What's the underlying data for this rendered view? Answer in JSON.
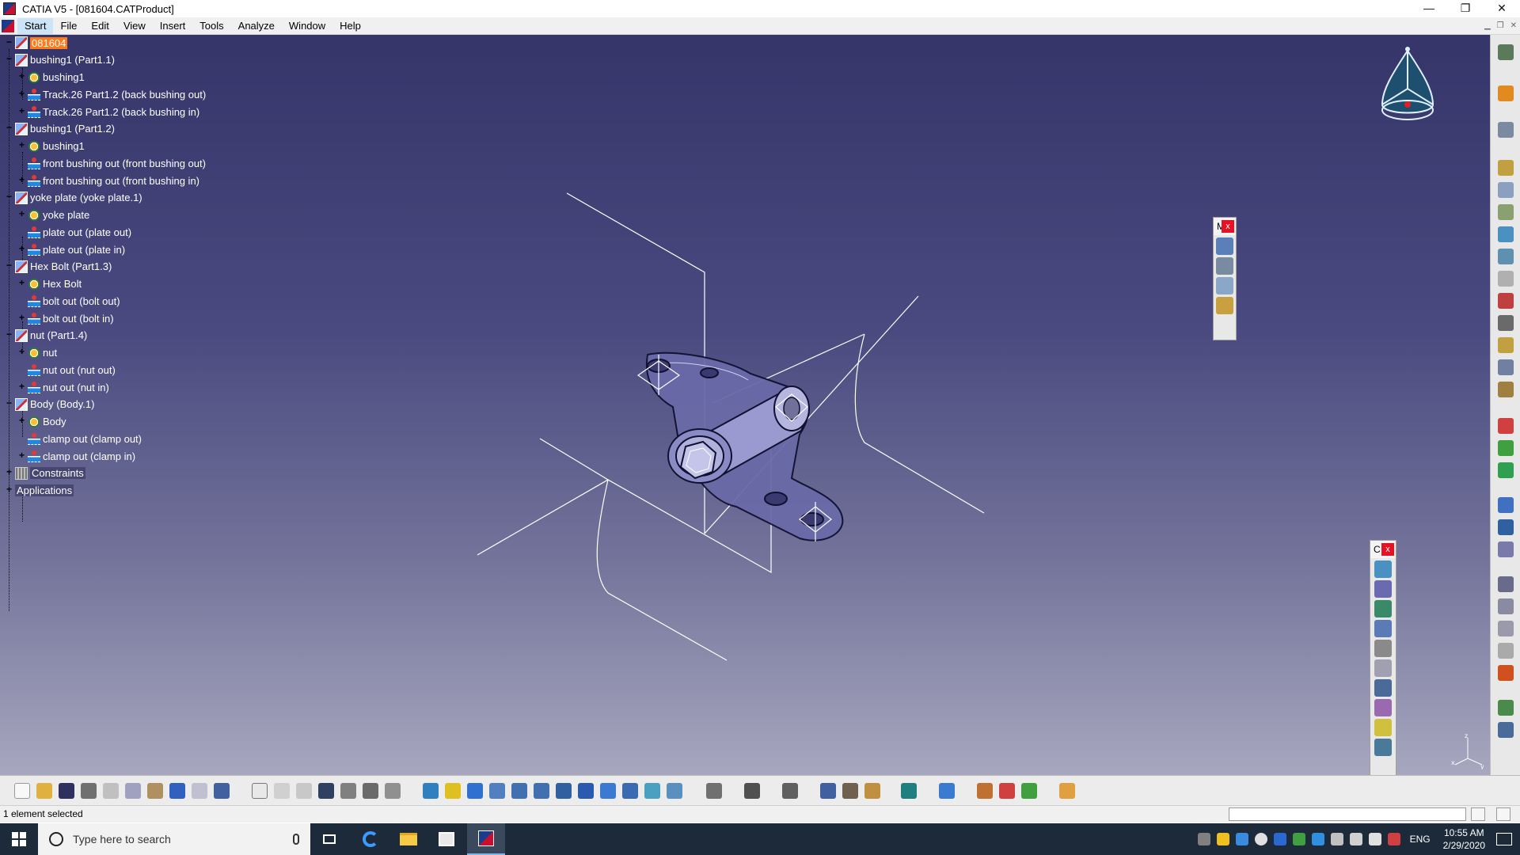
{
  "window": {
    "title": "CATIA V5 - [081604.CATProduct]",
    "minimize": "—",
    "maximize": "❐",
    "close": "✕"
  },
  "menu": {
    "items": [
      "Start",
      "File",
      "Edit",
      "View",
      "Insert",
      "Tools",
      "Analyze",
      "Window",
      "Help"
    ]
  },
  "tree": {
    "nodes": [
      {
        "label": "081604",
        "icon": "product-icon",
        "level": 0,
        "exp": "minus",
        "selected": true
      },
      {
        "label": "bushing1 (Part1.1)",
        "icon": "product-icon",
        "level": 1,
        "exp": "minus"
      },
      {
        "label": "bushing1",
        "icon": "part-icon",
        "level": 2,
        "exp": "plus"
      },
      {
        "label": "Track.26 Part1.2 (back bushing out)",
        "icon": "publication-icon",
        "level": 2,
        "exp": "plus"
      },
      {
        "label": "Track.26 Part1.2 (back bushing in)",
        "icon": "publication-icon",
        "level": 2,
        "exp": "plus"
      },
      {
        "label": "bushing1 (Part1.2)",
        "icon": "product-icon",
        "level": 1,
        "exp": "minus"
      },
      {
        "label": "bushing1",
        "icon": "part-icon",
        "level": 2,
        "exp": "plus"
      },
      {
        "label": "front bushing out (front bushing out)",
        "icon": "publication-icon",
        "level": 2,
        "exp": "none"
      },
      {
        "label": "front bushing out (front bushing in)",
        "icon": "publication-icon",
        "level": 2,
        "exp": "plus"
      },
      {
        "label": "yoke plate (yoke plate.1)",
        "icon": "product-icon",
        "level": 1,
        "exp": "minus"
      },
      {
        "label": "yoke plate",
        "icon": "part-icon",
        "level": 2,
        "exp": "plus"
      },
      {
        "label": "plate out (plate out)",
        "icon": "publication-icon",
        "level": 2,
        "exp": "none"
      },
      {
        "label": "plate out (plate in)",
        "icon": "publication-icon",
        "level": 2,
        "exp": "plus"
      },
      {
        "label": "Hex Bolt (Part1.3)",
        "icon": "product-icon",
        "level": 1,
        "exp": "minus"
      },
      {
        "label": "Hex Bolt",
        "icon": "part-icon",
        "level": 2,
        "exp": "plus"
      },
      {
        "label": "bolt out (bolt out)",
        "icon": "publication-icon",
        "level": 2,
        "exp": "none"
      },
      {
        "label": "bolt out (bolt in)",
        "icon": "publication-icon",
        "level": 2,
        "exp": "plus"
      },
      {
        "label": "nut (Part1.4)",
        "icon": "product-icon",
        "level": 1,
        "exp": "minus"
      },
      {
        "label": "nut",
        "icon": "part-icon",
        "level": 2,
        "exp": "plus"
      },
      {
        "label": "nut out (nut out)",
        "icon": "publication-icon",
        "level": 2,
        "exp": "none"
      },
      {
        "label": "nut out (nut in)",
        "icon": "publication-icon",
        "level": 2,
        "exp": "plus"
      },
      {
        "label": "Body (Body.1)",
        "icon": "product-icon",
        "level": 1,
        "exp": "minus"
      },
      {
        "label": "Body",
        "icon": "part-icon",
        "level": 2,
        "exp": "plus"
      },
      {
        "label": "clamp out (clamp out)",
        "icon": "publication-icon",
        "level": 2,
        "exp": "none"
      },
      {
        "label": "clamp out (clamp in)",
        "icon": "publication-icon",
        "level": 2,
        "exp": "plus"
      },
      {
        "label": "Constraints",
        "icon": "constraints-icon",
        "level": 1,
        "exp": "plus",
        "boxed": true
      },
      {
        "label": "Applications",
        "icon": "none",
        "level": 0,
        "exp": "plus",
        "boxed": true
      }
    ]
  },
  "floating_toolbars": {
    "top": {
      "title": "M",
      "close": "x",
      "icons": [
        "swap-icon",
        "manipulation-icon",
        "snap-icon",
        "smart-move-icon"
      ]
    },
    "bottom": {
      "title": "C",
      "close": "x",
      "icons": [
        "coincidence-icon",
        "contact-icon",
        "offset-icon",
        "angle-icon",
        "fix-icon",
        "fix-together-icon",
        "quick-constraint-icon",
        "flexible-rigid-icon",
        "change-constraint-icon",
        "reuse-pattern-icon"
      ]
    }
  },
  "status": {
    "text": "1 element selected",
    "command_value": ""
  },
  "taskbar": {
    "search_placeholder": "Type here to search",
    "lang": "ENG",
    "time": "10:55 AM",
    "date": "2/29/2020"
  },
  "colors": {
    "viewport_top": "#35356a",
    "viewport_bottom": "#a7a7bf",
    "selection": "#ff7a1a",
    "taskbar": "#1c2a3a",
    "close_red": "#e81123"
  }
}
